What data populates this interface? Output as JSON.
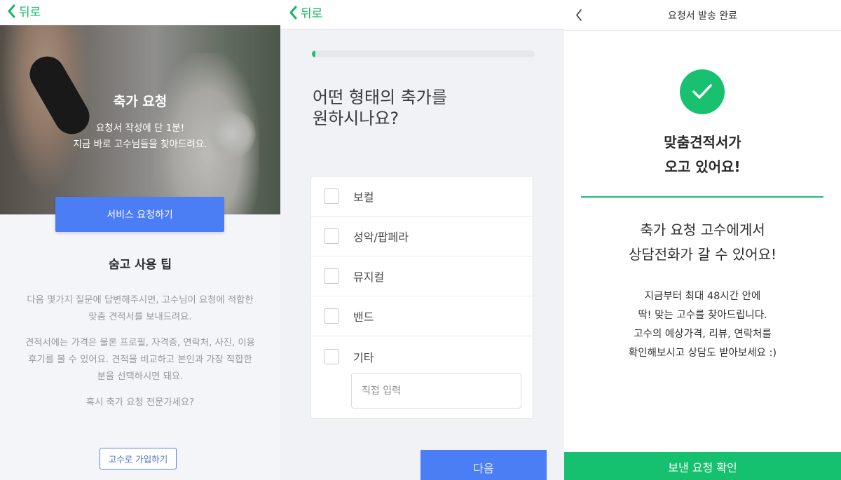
{
  "panel1": {
    "back_label": "뒤로",
    "hero_title": "축가 요청",
    "hero_sub_lines": [
      "요청서 작성에 단 1분!",
      "지금 바로 고수님들을 찾아드려요."
    ],
    "service_button": "서비스 요청하기",
    "tips_title": "숨고 사용 팁",
    "tips_p1_lines": [
      "다음 몇가지 질문에 답변해주시면, 고수님이 요청에 적합한",
      "맞춤 견적서를 보내드려요."
    ],
    "tips_p2_lines": [
      "견적서에는 가격은 물론 프로필, 자격증, 연락처, 사진, 이용",
      "후기를 볼 수 있어요. 견적을 비교하고 본인과 가장 적합한",
      "분을 선택하시면 돼요."
    ],
    "tips_p3": "혹시 축가 요청 전문가세요?",
    "join_button": "고수로 가입하기"
  },
  "panel2": {
    "back_label": "뒤로",
    "progress_fraction": 0.01,
    "question_lines": [
      "어떤 형태의 축가를",
      "원하시나요?"
    ],
    "options": [
      "보컬",
      "성악/팝페라",
      "뮤지컬",
      "밴드",
      "기타"
    ],
    "direct_input_placeholder": "직접 입력",
    "next_button": "다음"
  },
  "panel3": {
    "title": "요청서 발송 완료",
    "done_title_lines": [
      "맞춤견적서가",
      "오고 있어요!"
    ],
    "info_main_lines": [
      "축가 요청 고수에게서",
      "상담전화가 갈 수 있어요!"
    ],
    "info_sub_lines": [
      "지금부터 최대 48시간 안에",
      "딱! 맞는 고수를 찾아드립니다.",
      "고수의 예상가격, 리뷰, 연락처를",
      "확인해보시고 상담도 받아보세요 :)"
    ],
    "confirm_button": "보낸 요청 확인"
  },
  "colors": {
    "accent_green": "#17c16f",
    "accent_blue": "#4b7df5"
  }
}
